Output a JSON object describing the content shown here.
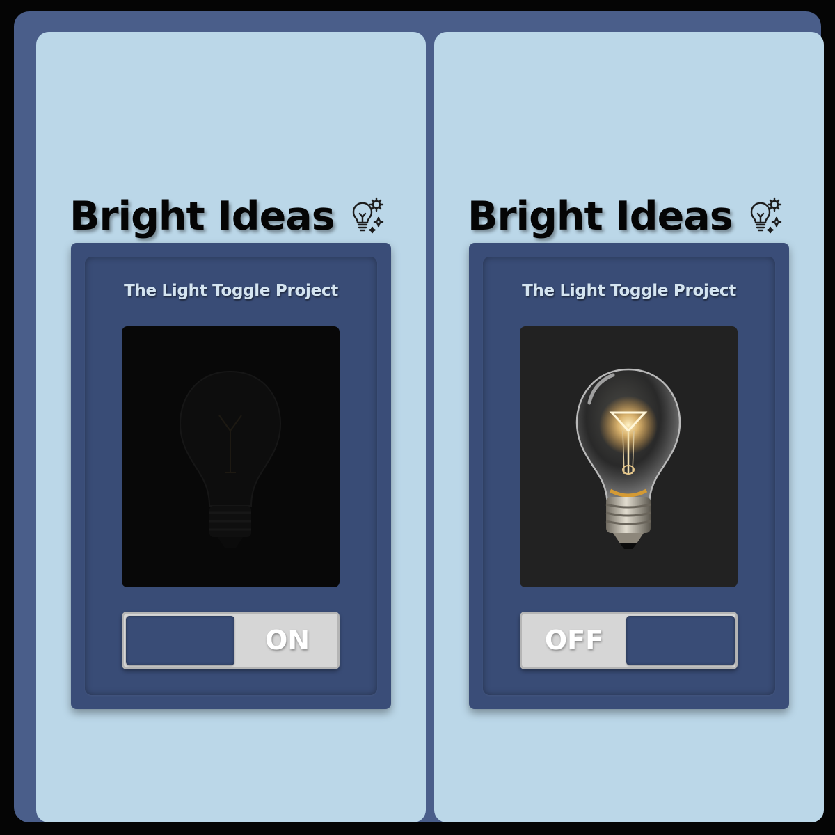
{
  "panels": [
    {
      "heading": "Bright Ideas",
      "heading_icon": "lightbulb-gear-sparkle-icon",
      "card_title": "The Light Toggle Project",
      "bulb_state": "off",
      "toggle": {
        "label": "ON"
      }
    },
    {
      "heading": "Bright Ideas",
      "heading_icon": "lightbulb-gear-sparkle-icon",
      "card_title": "The Light Toggle Project",
      "bulb_state": "lit",
      "toggle": {
        "label": "OFF"
      }
    }
  ],
  "colors": {
    "page_background": "#050505",
    "frame": "#4a5e8a",
    "panel": "#bbd7e8",
    "card": "#3a4d78",
    "toggle_track": "#d6d6d6",
    "bulb_glow": "#ffcf7a"
  }
}
